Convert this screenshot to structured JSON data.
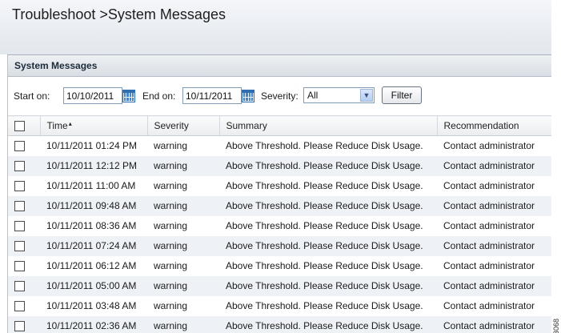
{
  "page": {
    "title": "Troubleshoot >System Messages"
  },
  "panel": {
    "title": "System Messages"
  },
  "filters": {
    "start_label": "Start on:",
    "start_value": "10/10/2011",
    "end_label": "End on:",
    "end_value": "10/11/2011",
    "severity_label": "Severity:",
    "severity_value": "All",
    "filter_button": "Filter"
  },
  "table": {
    "columns": [
      "Time",
      "Severity",
      "Summary",
      "Recommendation"
    ],
    "sort_indicator": "▴",
    "rows": [
      {
        "time": "10/11/2011 01:24 PM",
        "severity": "warning",
        "summary": "Above Threshold. Please Reduce Disk Usage.",
        "recommendation": "Contact administrator"
      },
      {
        "time": "10/11/2011 12:12 PM",
        "severity": "warning",
        "summary": "Above Threshold. Please Reduce Disk Usage.",
        "recommendation": "Contact administrator"
      },
      {
        "time": "10/11/2011 11:00 AM",
        "severity": "warning",
        "summary": "Above Threshold. Please Reduce Disk Usage.",
        "recommendation": "Contact administrator"
      },
      {
        "time": "10/11/2011 09:48 AM",
        "severity": "warning",
        "summary": "Above Threshold. Please Reduce Disk Usage.",
        "recommendation": "Contact administrator"
      },
      {
        "time": "10/11/2011 08:36 AM",
        "severity": "warning",
        "summary": "Above Threshold. Please Reduce Disk Usage.",
        "recommendation": "Contact administrator"
      },
      {
        "time": "10/11/2011 07:24 AM",
        "severity": "warning",
        "summary": "Above Threshold. Please Reduce Disk Usage.",
        "recommendation": "Contact administrator"
      },
      {
        "time": "10/11/2011 06:12 AM",
        "severity": "warning",
        "summary": "Above Threshold. Please Reduce Disk Usage.",
        "recommendation": "Contact administrator"
      },
      {
        "time": "10/11/2011 05:00 AM",
        "severity": "warning",
        "summary": "Above Threshold. Please Reduce Disk Usage.",
        "recommendation": "Contact administrator"
      },
      {
        "time": "10/11/2011 03:48 AM",
        "severity": "warning",
        "summary": "Above Threshold. Please Reduce Disk Usage.",
        "recommendation": "Contact administrator"
      },
      {
        "time": "10/11/2011 02:36 AM",
        "severity": "warning",
        "summary": "Above Threshold. Please Reduce Disk Usage.",
        "recommendation": "Contact administrator"
      }
    ]
  },
  "figure_id": "343068",
  "icons": {
    "calendar": "calendar-icon",
    "dropdown": "chevron-down-icon",
    "checkbox": "checkbox"
  },
  "colors": {
    "row_alt": "#eef2f7",
    "header_bg": "#d9dee4",
    "field_border": "#7f9db9"
  }
}
